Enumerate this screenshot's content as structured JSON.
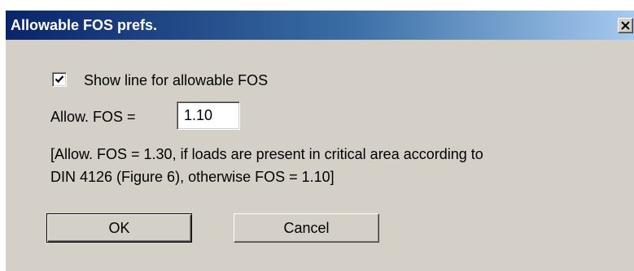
{
  "dialog": {
    "title": "Allowable FOS prefs.",
    "close_icon": "close-icon"
  },
  "options": {
    "show_line_label": "Show line for allowable FOS",
    "show_line_checked": true
  },
  "fos": {
    "label": "Allow. FOS =",
    "value": "1.10"
  },
  "note": {
    "line1": "[Allow. FOS = 1.30, if loads are present in critical area according to",
    "line2": "DIN 4126 (Figure 6), otherwise FOS = 1.10]"
  },
  "buttons": {
    "ok_label": "OK",
    "cancel_label": "Cancel"
  },
  "colors": {
    "titlebar_start": "#0a246a",
    "titlebar_end": "#a6caf0",
    "dialog_background": "#d4d0c8"
  }
}
